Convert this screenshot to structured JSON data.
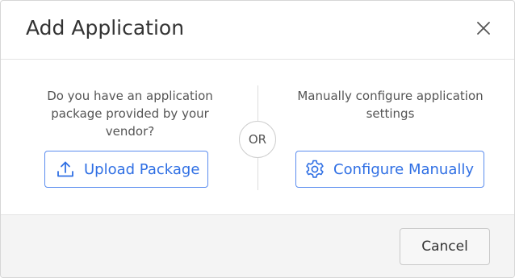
{
  "dialog": {
    "title": "Add Application",
    "close_icon": "close-icon"
  },
  "left_option": {
    "prompt_lines": [
      "Do you have an application",
      "package provided by your",
      "vendor?"
    ],
    "button_label": "Upload Package",
    "button_icon": "upload-icon"
  },
  "separator": {
    "label": "OR"
  },
  "right_option": {
    "prompt_lines": [
      "Manually configure application",
      "settings"
    ],
    "button_label": "Configure Manually",
    "button_icon": "gear-icon"
  },
  "footer": {
    "cancel_label": "Cancel"
  },
  "colors": {
    "accent": "#2f6fe4",
    "accent_border": "#5b8def",
    "footer_bg": "#f4f4f4"
  }
}
